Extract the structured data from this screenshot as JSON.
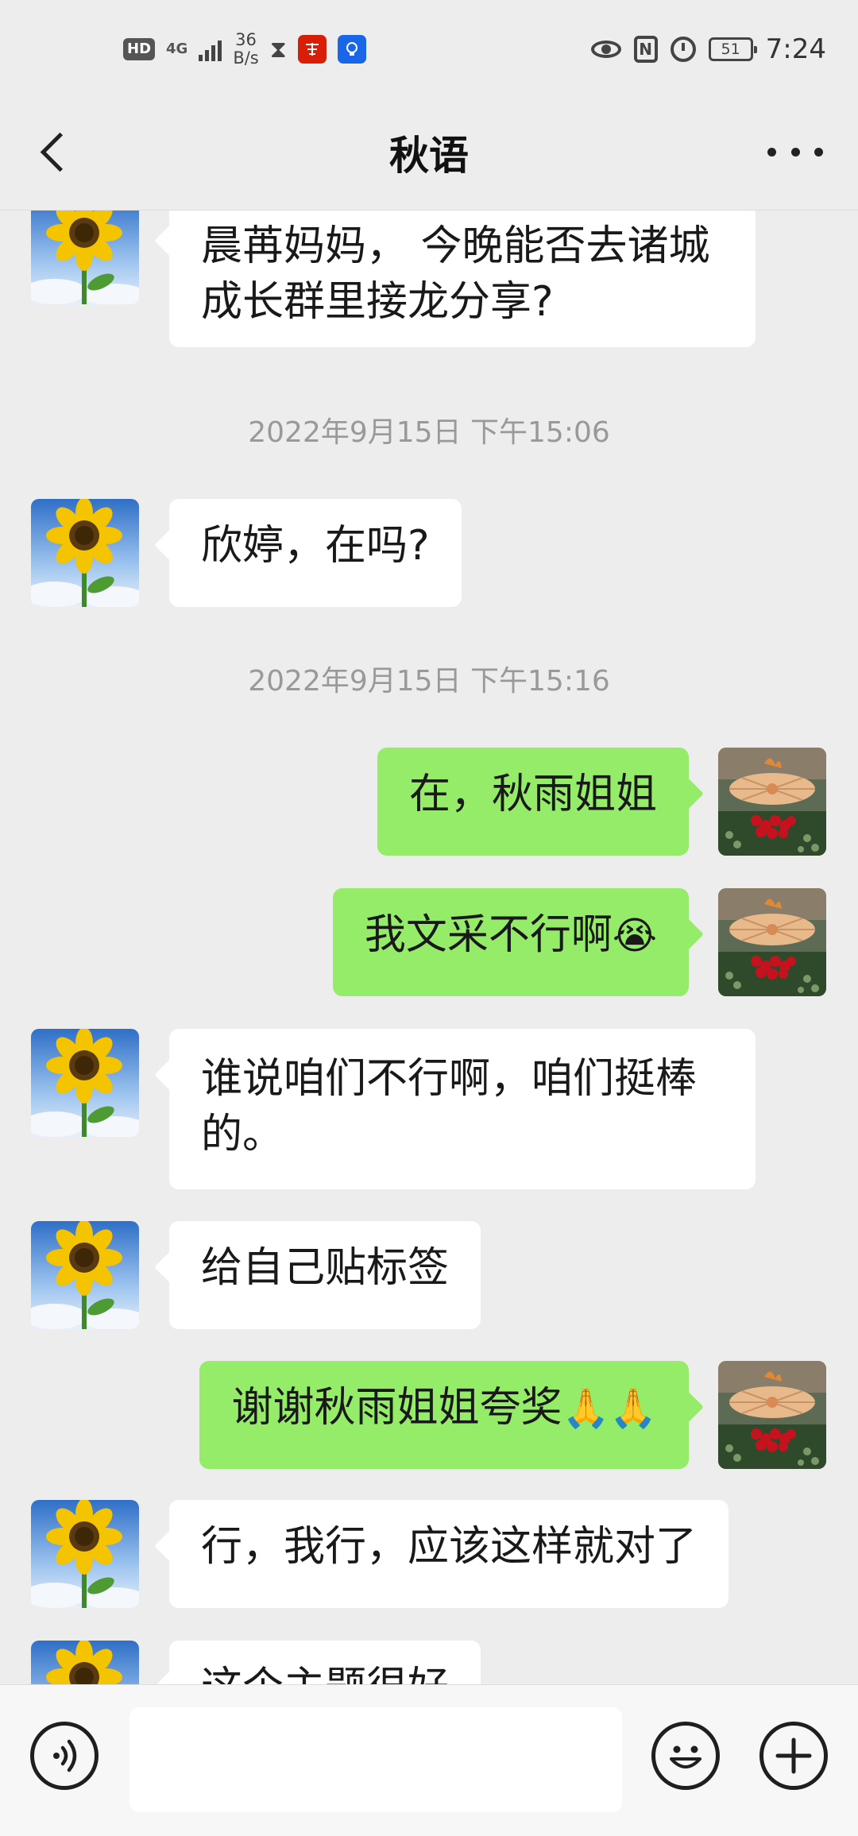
{
  "status_bar": {
    "hd": "HD",
    "network": "4G",
    "speed_value": "36",
    "speed_unit": "B/s",
    "battery": "51",
    "time": "7:24"
  },
  "header": {
    "title": "秋语"
  },
  "chat": {
    "timestamps": [
      "2022年9月15日 下午15:06",
      "2022年9月15日 下午15:16"
    ],
    "messages": [
      {
        "sender": "them",
        "text": "晨苒妈妈， 今晚能否去诸城成长群里接龙分享?"
      },
      {
        "sender": "them",
        "text": "欣婷，在吗?"
      },
      {
        "sender": "me",
        "text": "在，秋雨姐姐"
      },
      {
        "sender": "me",
        "text": "我文采不行啊",
        "emoji": "😭"
      },
      {
        "sender": "them",
        "text": "谁说咱们不行啊，咱们挺棒的。"
      },
      {
        "sender": "them",
        "text": "给自己贴标签"
      },
      {
        "sender": "me",
        "text": "谢谢秋雨姐姐夸奖",
        "emoji": "🙏🙏"
      },
      {
        "sender": "them",
        "text": "行，我行，应该这样就对了"
      },
      {
        "sender": "them",
        "text": "这个主题很好"
      }
    ]
  },
  "input_bar": {
    "voice_icon": "voice-icon",
    "emoji_icon": "smiley-icon",
    "plus_icon": "plus-icon"
  },
  "colors": {
    "background": "#ededed",
    "my_bubble": "#95ec69",
    "their_bubble": "#ffffff",
    "timestamp": "#999999"
  }
}
